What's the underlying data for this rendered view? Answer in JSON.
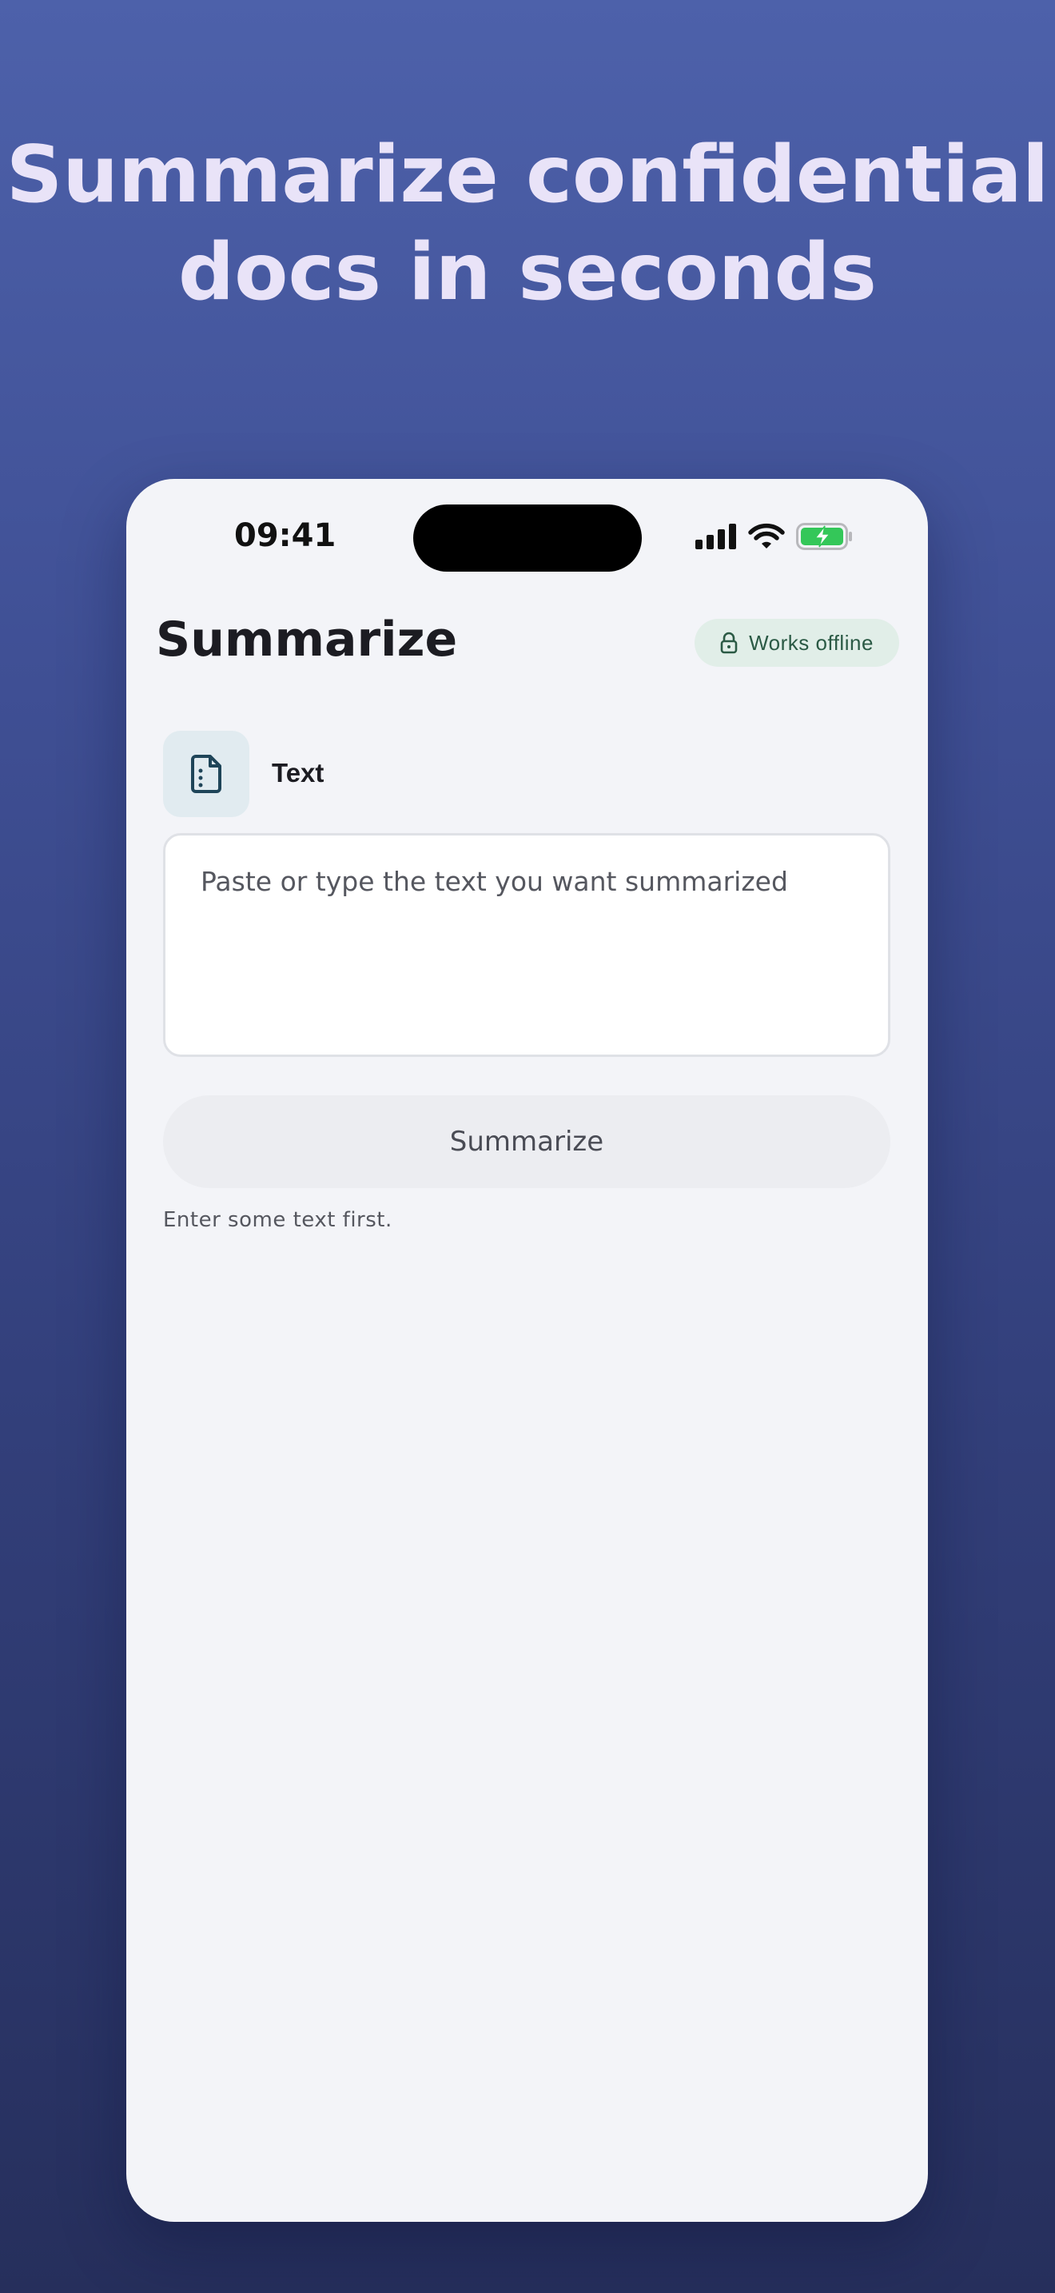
{
  "headline": {
    "line1": "Summarize confidential",
    "line2": "docs in seconds"
  },
  "status_bar": {
    "time": "09:41",
    "icons": [
      "cellular-signal-icon",
      "wifi-icon",
      "battery-charging-icon"
    ],
    "battery_color": "#34c759"
  },
  "header": {
    "title": "Summarize",
    "badge": {
      "label": "Works offline",
      "icon": "lock-icon",
      "color": "#2b5a45",
      "background": "#e1eee8"
    }
  },
  "input_section": {
    "icon": "document-icon",
    "label": "Text",
    "textarea": {
      "value": "",
      "placeholder": "Paste or type the text you want summarized"
    }
  },
  "action": {
    "button_label": "Summarize",
    "hint": "Enter some text first."
  }
}
